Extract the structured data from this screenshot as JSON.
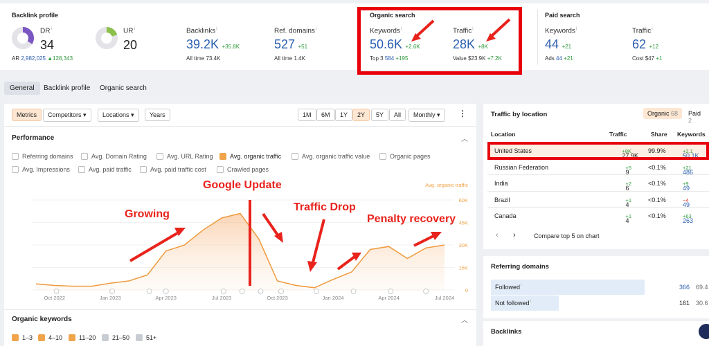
{
  "metrics": {
    "backlink_profile": {
      "title": "Backlink profile",
      "dr": {
        "label": "DR",
        "value": "34"
      },
      "ur": {
        "label": "UR",
        "value": "20"
      },
      "ar": {
        "label": "AR",
        "value": "2,982,025",
        "delta": "▲128,343"
      },
      "backlinks": {
        "label": "Backlinks",
        "value": "39.2K",
        "delta": "+35.8K",
        "sub": "All time 73.4K"
      },
      "ref_domains": {
        "label": "Ref. domains",
        "value": "527",
        "delta": "+51",
        "sub": "All time 1.4K"
      }
    },
    "organic_search": {
      "title": "Organic search",
      "keywords": {
        "label": "Keywords",
        "value": "50.6K",
        "delta": "+2.6K",
        "sub_label": "Top 3",
        "sub_value": "584",
        "sub_delta": "+195"
      },
      "traffic": {
        "label": "Traffic",
        "value": "28K",
        "delta": "+8K",
        "sub_label": "Value",
        "sub_value": "$23.9K",
        "sub_delta": "+7.2K"
      }
    },
    "paid_search": {
      "title": "Paid search",
      "keywords": {
        "label": "Keywords",
        "value": "44",
        "delta": "+21",
        "sub_label": "Ads",
        "sub_value": "44",
        "sub_delta": "+21"
      },
      "traffic": {
        "label": "Traffic",
        "value": "62",
        "delta": "+12",
        "sub_label": "Cost",
        "sub_value": "$47",
        "sub_delta": "+1"
      }
    }
  },
  "tabs": [
    "General",
    "Backlink profile",
    "Organic search"
  ],
  "toolbar": {
    "metrics": "Metrics",
    "competitors": "Competitors",
    "locations": "Locations",
    "years": "Years",
    "ranges": [
      "1M",
      "6M",
      "1Y",
      "2Y",
      "5Y",
      "All"
    ],
    "interval": "Monthly"
  },
  "performance": {
    "title": "Performance",
    "checkboxes": [
      {
        "label": "Referring domains",
        "checked": false
      },
      {
        "label": "Avg. Domain Rating",
        "checked": false
      },
      {
        "label": "Avg. URL Rating",
        "checked": false
      },
      {
        "label": "Avg. organic traffic",
        "checked": true
      },
      {
        "label": "Avg. organic traffic value",
        "checked": false
      },
      {
        "label": "Organic pages",
        "checked": false
      },
      {
        "label": "Avg. Impressions",
        "checked": false
      },
      {
        "label": "Avg. paid traffic",
        "checked": false
      },
      {
        "label": "Avg. paid traffic cost",
        "checked": false
      },
      {
        "label": "Crawled pages",
        "checked": false
      }
    ]
  },
  "chart_data": {
    "type": "area",
    "series_label": "Avg. organic traffic",
    "x_ticks": [
      "Oct 2022",
      "Jan 2023",
      "Apr 2023",
      "Jul 2023",
      "Oct 2023",
      "Jan 2024",
      "Apr 2024",
      "Jul 2024"
    ],
    "y_ticks": [
      "60K",
      "45K",
      "30K",
      "15K",
      "0"
    ],
    "ylim": [
      0,
      60000
    ],
    "values": [
      4000,
      3000,
      2500,
      2500,
      4500,
      6000,
      10000,
      26000,
      30000,
      40000,
      48000,
      51000,
      34000,
      6000,
      3000,
      1500,
      7000,
      12000,
      27000,
      29000,
      21000,
      28000,
      30000
    ]
  },
  "annotations": {
    "growing": "Growing",
    "google_update": "Google Update",
    "traffic_drop": "Traffic Drop",
    "penalty_recovery": "Penalty recovery"
  },
  "organic_keywords": {
    "title": "Organic keywords",
    "filters": [
      {
        "label": "1–3",
        "checked": true
      },
      {
        "label": "4–10",
        "checked": true
      },
      {
        "label": "11–20",
        "checked": true
      },
      {
        "label": "21–50",
        "checked": true
      },
      {
        "label": "51+",
        "checked": true
      }
    ]
  },
  "traffic_by_location": {
    "title": "Traffic by location",
    "organic_tab": "Organic",
    "organic_count": "68",
    "paid_tab": "Paid",
    "paid_count": "2",
    "headers": [
      "Location",
      "Traffic",
      "Share",
      "Keywords"
    ],
    "rows": [
      {
        "location": "United States",
        "traffic": "27.9K",
        "traffic_delta": "+8K",
        "share": "99.9%",
        "keywords": "50.1K",
        "kw_delta": "+2.1"
      },
      {
        "location": "Russian Federation",
        "traffic": "9",
        "traffic_delta": "+5",
        "share": "<0.1%",
        "keywords": "486",
        "kw_delta": "+21"
      },
      {
        "location": "India",
        "traffic": "6",
        "traffic_delta": "+2",
        "share": "<0.1%",
        "keywords": "49",
        "kw_delta": "+9"
      },
      {
        "location": "Brazil",
        "traffic": "4",
        "traffic_delta": "+1",
        "share": "<0.1%",
        "keywords": "49",
        "kw_delta": "−4"
      },
      {
        "location": "Canada",
        "traffic": "4",
        "traffic_delta": "+1",
        "share": "<0.1%",
        "keywords": "263",
        "kw_delta": "+63"
      }
    ],
    "compare": "Compare top 5 on chart"
  },
  "referring_domains": {
    "title": "Referring domains",
    "rows": [
      {
        "label": "Followed",
        "value": "366",
        "pct": "69.4",
        "share": 0.694
      },
      {
        "label": "Not followed",
        "value": "161",
        "pct": "30.6",
        "share": 0.306
      }
    ]
  },
  "backlinks_section": {
    "title": "Backlinks"
  }
}
